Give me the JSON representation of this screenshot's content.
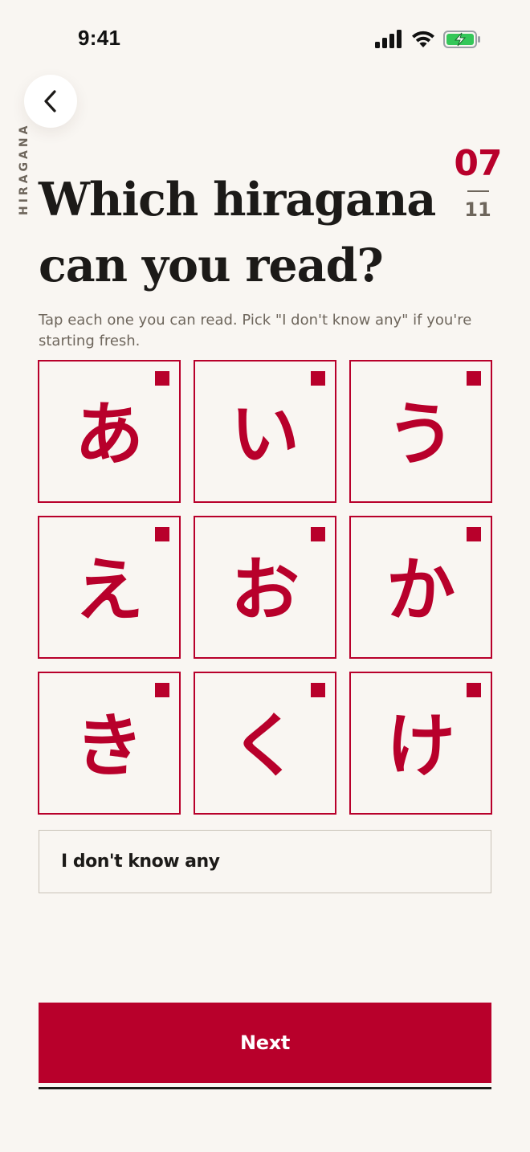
{
  "status_bar": {
    "time": "9:41",
    "icons": [
      "signal-icon",
      "wifi-icon",
      "battery-charging-icon"
    ]
  },
  "header": {
    "side_label": "HIRAGANA",
    "step_current": "07",
    "step_total": "11"
  },
  "main": {
    "title": "Which hiragana can you read?",
    "subtitle": "Tap each one you can read. Pick \"I don't know any\" if you're starting fresh.",
    "kana_tiles": [
      {
        "char": "あ",
        "selected": true
      },
      {
        "char": "い",
        "selected": true
      },
      {
        "char": "う",
        "selected": true
      },
      {
        "char": "え",
        "selected": true
      },
      {
        "char": "お",
        "selected": true
      },
      {
        "char": "か",
        "selected": true
      },
      {
        "char": "き",
        "selected": true
      },
      {
        "char": "く",
        "selected": true
      },
      {
        "char": "け",
        "selected": true
      }
    ],
    "dont_know_label": "I don't know any"
  },
  "footer": {
    "next_label": "Next"
  },
  "colors": {
    "accent": "#b8002b",
    "background": "#f9f6f2",
    "text": "#1c1a18",
    "muted": "#6e665c",
    "battery": "#34c759"
  }
}
